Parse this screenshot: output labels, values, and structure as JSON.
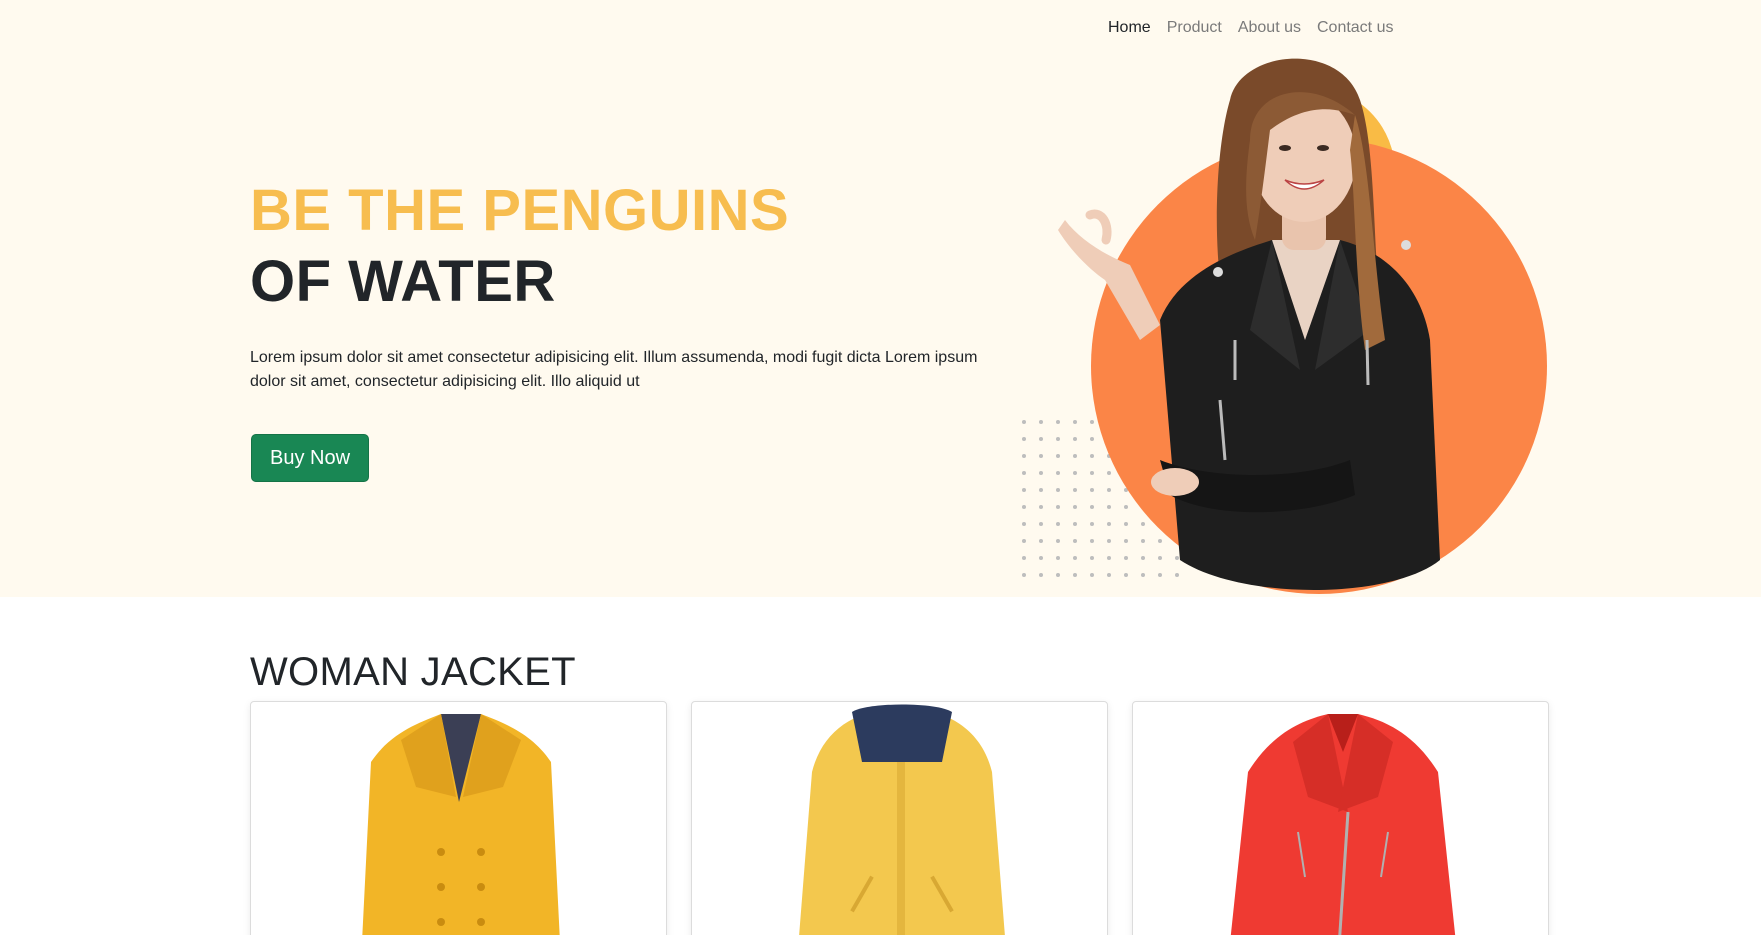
{
  "nav": {
    "items": [
      {
        "label": "Home",
        "active": true
      },
      {
        "label": "Product",
        "active": false
      },
      {
        "label": "About us",
        "active": false
      },
      {
        "label": "Contact us",
        "active": false
      }
    ]
  },
  "hero": {
    "headline_line1": "BE THE PENGUINS",
    "headline_line2": "OF WATER",
    "description": "Lorem ipsum dolor sit amet consectetur adipisicing elit. Illum assumenda, modi fugit dicta Lorem ipsum dolor sit amet, consectetur adipisicing elit. Illo aliquid ut",
    "button_label": "Buy Now"
  },
  "products": {
    "section_title": "WOMAN JACKET",
    "items": [
      {
        "name": "yellow-coat",
        "color": "#f2b527"
      },
      {
        "name": "yellow-raincoat",
        "color": "#f3c84e"
      },
      {
        "name": "red-leather-jacket",
        "color": "#ef3a32"
      }
    ]
  },
  "colors": {
    "accent_yellow": "#f7bd4f",
    "accent_orange": "#fb8547",
    "button_green": "#198754",
    "hero_background": "#fffaef"
  }
}
